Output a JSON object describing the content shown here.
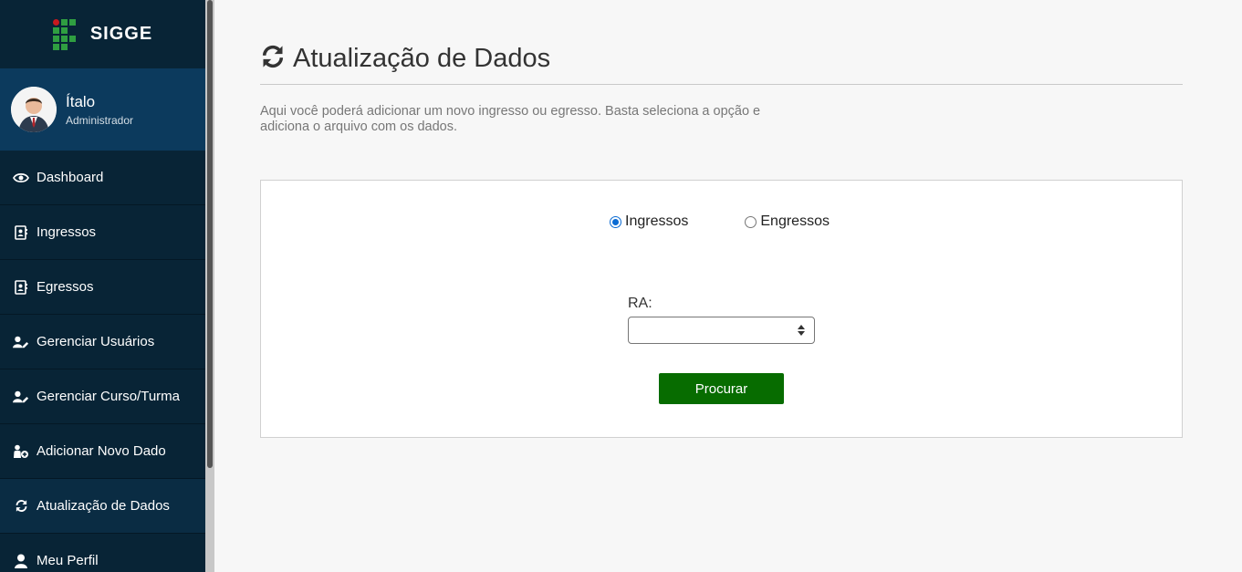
{
  "brand": {
    "name": "SIGGE",
    "logo_icon": "if-logo-icon",
    "logo_color": "#2f9e41",
    "logo_dot_color": "#c8191e"
  },
  "user": {
    "name": "Ítalo",
    "role": "Administrador"
  },
  "nav": [
    {
      "label": "Dashboard",
      "icon": "eye-icon"
    },
    {
      "label": "Ingressos",
      "icon": "contact-card-icon"
    },
    {
      "label": "Egressos",
      "icon": "contact-card-icon"
    },
    {
      "label": "Gerenciar Usuários",
      "icon": "user-edit-icon"
    },
    {
      "label": "Gerenciar Curso/Turma",
      "icon": "user-edit-icon"
    },
    {
      "label": "Adicionar Novo Dado",
      "icon": "user-add-icon"
    },
    {
      "label": "Atualização de Dados",
      "icon": "sync-icon"
    },
    {
      "label": "Meu Perfil",
      "icon": "user-icon"
    }
  ],
  "page": {
    "title": "Atualização de Dados",
    "title_icon": "sync-icon",
    "description": "Aqui você poderá adicionar um novo ingresso ou egresso. Basta seleciona a opção e adiciona o arquivo com os dados."
  },
  "form": {
    "radio_options": [
      {
        "label": "Ingressos",
        "checked": true
      },
      {
        "label": "Engressos",
        "checked": false
      }
    ],
    "ra_label": "RA:",
    "ra_value": "",
    "submit_label": "Procurar"
  },
  "colors": {
    "sidebar_bg": "#082436",
    "user_card_bg": "#0c3a5d",
    "primary_button": "#076c00",
    "radio_accent": "#0b6bd3"
  }
}
